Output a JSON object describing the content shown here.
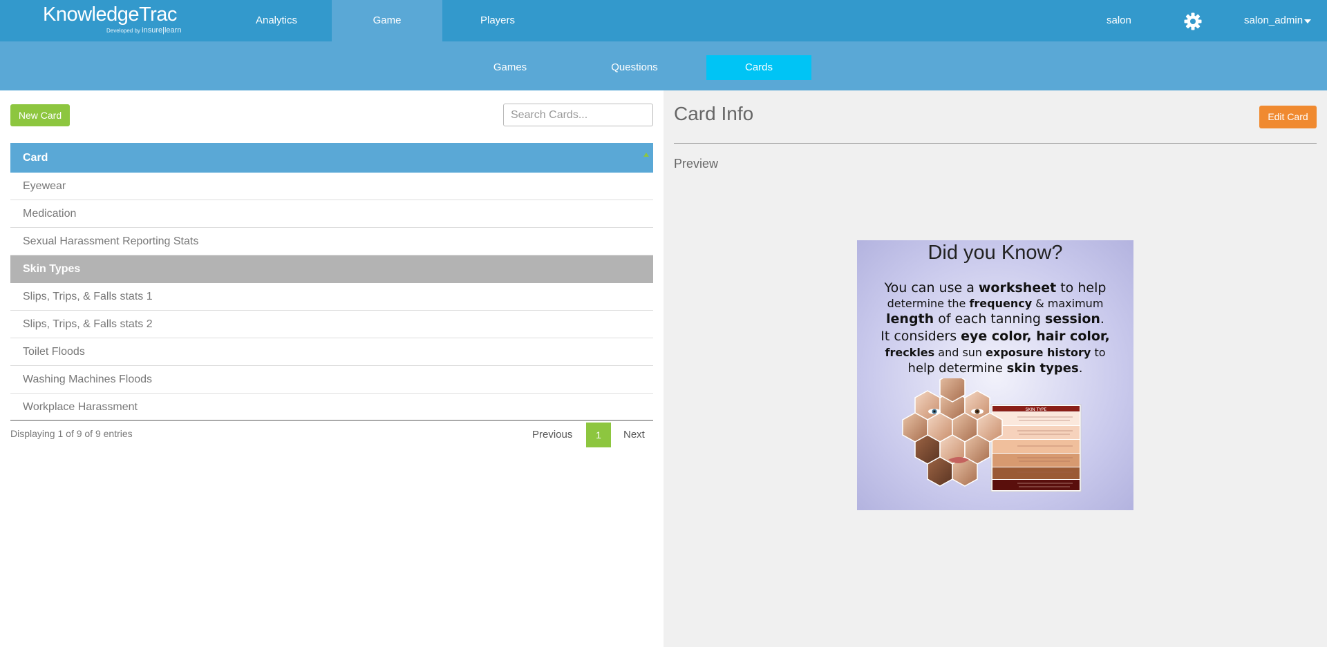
{
  "header": {
    "logo_text": "KnowledgeTrac",
    "logo_sub_prefix": "Developed by",
    "logo_sub_brand": "insure|learn",
    "tabs": [
      {
        "label": "Analytics",
        "active": false
      },
      {
        "label": "Game",
        "active": true
      },
      {
        "label": "Players",
        "active": false
      }
    ],
    "org": "salon",
    "settings_icon": "gear-icon",
    "user": "salon_admin"
  },
  "subnav": {
    "tabs": [
      {
        "label": "Games",
        "active": false
      },
      {
        "label": "Questions",
        "active": false
      },
      {
        "label": "Cards",
        "active": true
      }
    ]
  },
  "list": {
    "new_button": "New Card",
    "search_placeholder": "Search Cards...",
    "column_header": "Card",
    "rows": [
      {
        "label": "Eyewear",
        "selected": false
      },
      {
        "label": "Medication",
        "selected": false
      },
      {
        "label": "Sexual Harassment Reporting Stats",
        "selected": false
      },
      {
        "label": "Skin Types",
        "selected": true
      },
      {
        "label": "Slips, Trips, & Falls stats 1",
        "selected": false
      },
      {
        "label": "Slips, Trips, & Falls stats 2",
        "selected": false
      },
      {
        "label": "Toilet Floods",
        "selected": false
      },
      {
        "label": "Washing Machines Floods",
        "selected": false
      },
      {
        "label": "Workplace Harassment",
        "selected": false
      }
    ],
    "info": "Displaying 1 of 9 of 9 entries",
    "pagination": {
      "previous": "Previous",
      "page": "1",
      "next": "Next"
    }
  },
  "detail": {
    "title": "Card Info",
    "edit_button": "Edit Card",
    "preview_label": "Preview",
    "card": {
      "title": "Did you Know?",
      "lines": [
        [
          {
            "t": "You can use a "
          },
          {
            "t": "worksheet",
            "b": true
          },
          {
            "t": " to help"
          }
        ],
        [
          {
            "t": "determine the "
          },
          {
            "t": "frequency",
            "b": true
          },
          {
            "t": " & maximum"
          }
        ],
        [
          {
            "t": "length",
            "b": true
          },
          {
            "t": " of each tanning "
          },
          {
            "t": "session",
            "b": true
          },
          {
            "t": "."
          }
        ],
        [
          {
            "t": "It considers "
          },
          {
            "t": "eye color, hair color,",
            "b": true
          }
        ],
        [
          {
            "t": "freckles",
            "b": true
          },
          {
            "t": " and sun "
          },
          {
            "t": "exposure history",
            "b": true
          },
          {
            "t": " to"
          }
        ],
        [
          {
            "t": "help determine "
          },
          {
            "t": "skin types",
            "b": true
          },
          {
            "t": "."
          }
        ]
      ],
      "chart_heading": "SKIN TYPE"
    }
  },
  "colors": {
    "primary": "#3399cc",
    "secondary": "#5aa8d6",
    "active_sub": "#00c4f5",
    "green": "#8dc63f",
    "orange": "#f08a30",
    "selected_row": "#b3b3b3"
  }
}
